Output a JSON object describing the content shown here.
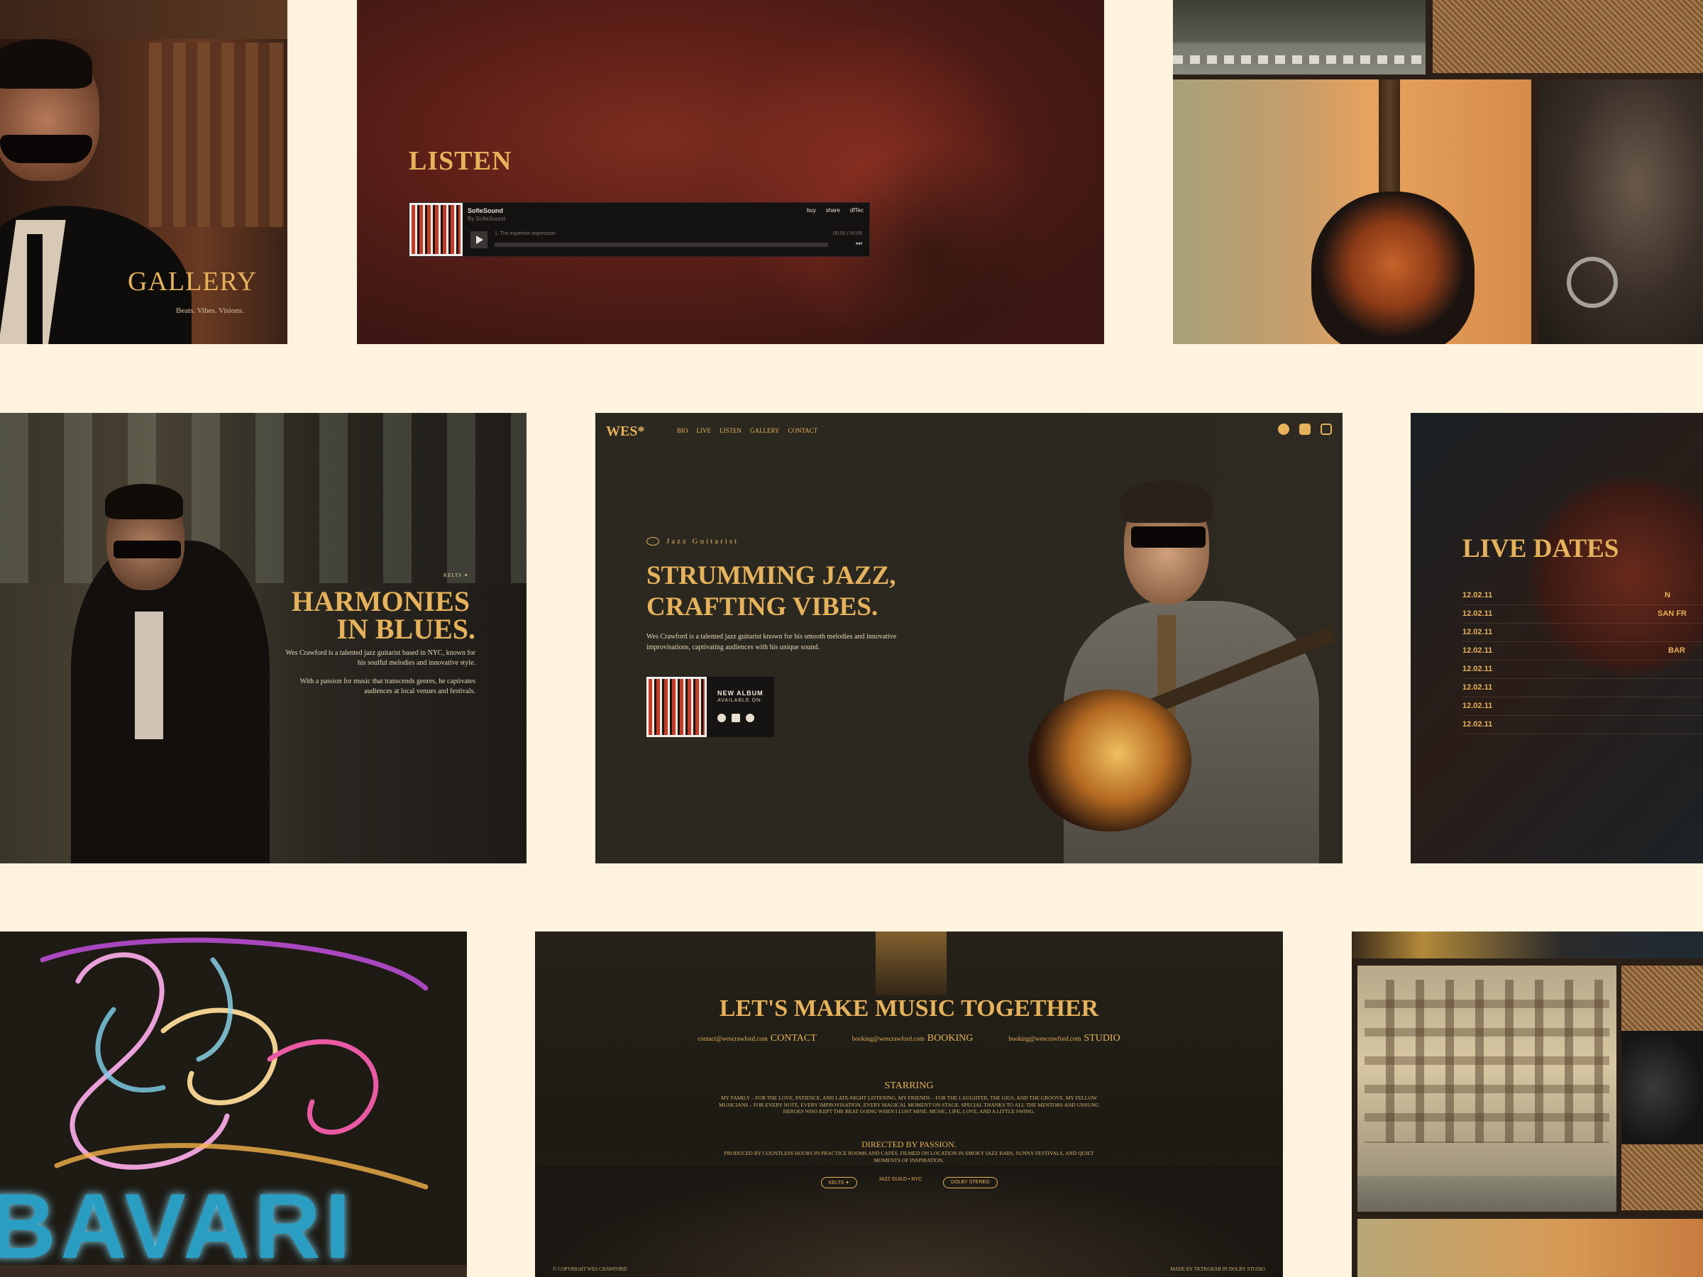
{
  "gallery": {
    "title": "GALLERY",
    "subtitle": "Beats. Vibes. Visions."
  },
  "listen": {
    "title": "LISTEN",
    "player": {
      "title": "SofieSound",
      "by": "By SofieSound",
      "buttons": [
        "buy",
        "share",
        "dfTec"
      ],
      "track": "1. The expertise impression",
      "time": "00:00 / 00:09"
    }
  },
  "harmonies": {
    "tag": "KELTS ✦",
    "title_line1": "HARMONIES",
    "title_line2": "IN BLUES.",
    "p1": "Wes Crawford is a talented jazz guitarist based in NYC, known for his soulful melodies and innovative style.",
    "p2": "With a passion for music that transcends genres, he captivates audiences at local venues and festivals."
  },
  "hero": {
    "logo": "WES*",
    "nav": [
      "BIO",
      "LIVE",
      "LISTEN",
      "GALLERY",
      "CONTACT"
    ],
    "socials": [
      "spotify-icon",
      "youtube-icon",
      "instagram-icon"
    ],
    "eyebrow": "Jazz Guitarist",
    "headline_line1": "STRUMMING JAZZ,",
    "headline_line2": "CRAFTING VIBES.",
    "description": "Wes Crawford is a talented jazz guitarist known for his smooth melodies and innovative improvisations, captivating audiences with his unique sound.",
    "album_new": "NEW ALBUM",
    "album_available": "AVAILABLE ON:"
  },
  "live": {
    "title": "LIVE DATES",
    "dates": [
      {
        "date": "12.02.11",
        "city": "N"
      },
      {
        "date": "12.02.11",
        "city": "SAN FR"
      },
      {
        "date": "12.02.11",
        "city": ""
      },
      {
        "date": "12.02.11",
        "city": "BAR"
      },
      {
        "date": "12.02.11",
        "city": ""
      },
      {
        "date": "12.02.11",
        "city": ""
      },
      {
        "date": "12.02.11",
        "city": ""
      },
      {
        "date": "12.02.11",
        "city": ""
      }
    ]
  },
  "neon": {
    "sign_text": "BAVARI"
  },
  "contact": {
    "title": "LET'S MAKE MUSIC TOGETHER",
    "links": [
      {
        "email": "contact@wescrawford.com",
        "label": "CONTACT"
      },
      {
        "email": "booking@wescrawford.com",
        "label": "BOOKING"
      },
      {
        "email": "booking@wescrawford.com",
        "label": "STUDIO"
      }
    ],
    "starring": "STARRING",
    "credits": "MY FAMILY – FOR THE LOVE, PATIENCE, AND LATE-NIGHT LISTENING. MY FRIENDS – FOR THE LAUGHTER, THE GIGS, AND THE GROOVE. MY FELLOW MUSICIANS – FOR EVERY NOTE, EVERY IMPROVISATION, EVERY MAGICAL MOMENT ON STAGE. SPECIAL THANKS TO ALL THE MENTORS AND UNSUNG HEROES WHO KEPT THE BEAT GOING WHEN I LOST MINE. MUSIC, LIFE, LOVE, AND A LITTLE SWING.",
    "directed": "DIRECTED BY PASSION.",
    "credits2": "PRODUCED BY COUNTLESS HOURS IN PRACTICE ROOMS AND CAFES. FILMED ON LOCATION IN SMOKY JAZZ BARS, SUNNY FESTIVALS, AND QUIET MOMENTS OF INSPIRATION.",
    "badges": [
      "KELTS ✦",
      "JAZZ GUILD • NYC",
      "DOLBY STEREO"
    ],
    "copyright": "© COPYRIGHT WES CRAWFORD",
    "made_by": "MADE BY TKTKGRAB IN DOLBY STUDIO"
  },
  "colors": {
    "background": "#fdf3df",
    "accent": "#e6b25b",
    "dark": "#2b2820"
  }
}
